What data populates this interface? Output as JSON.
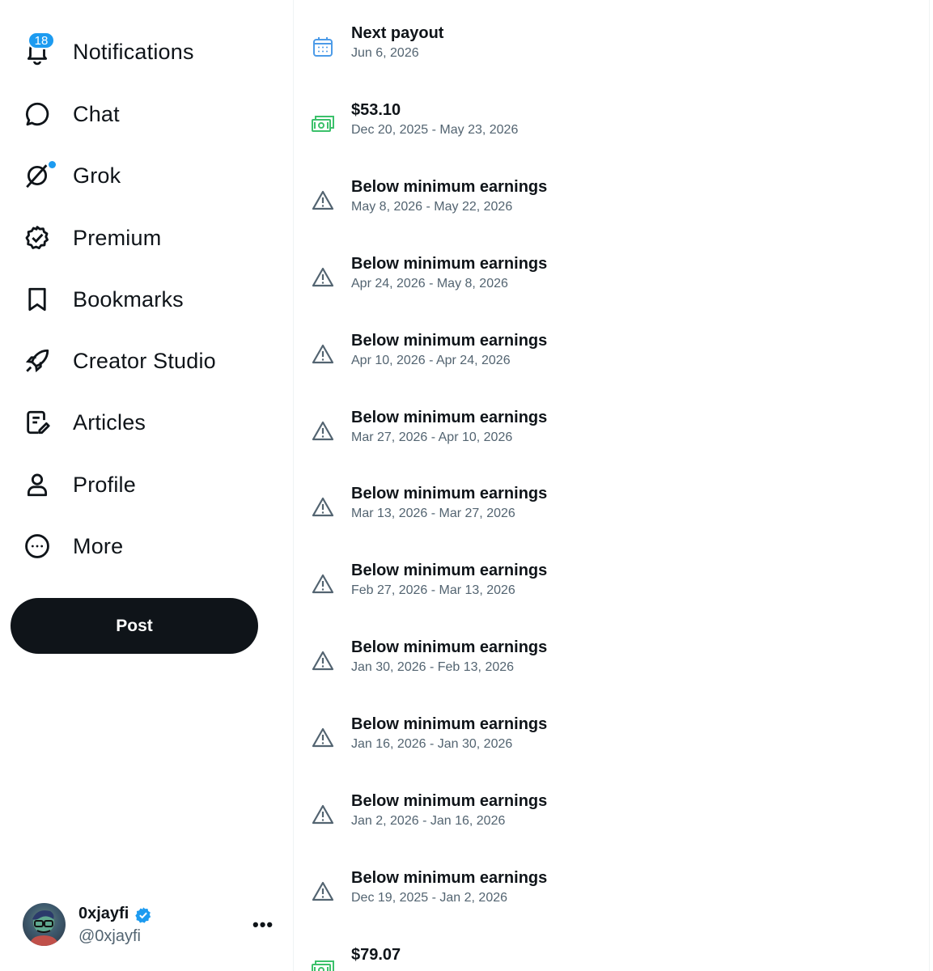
{
  "nav": {
    "items": [
      {
        "label": "Notifications",
        "icon": "bell-icon",
        "badge": "18"
      },
      {
        "label": "Chat",
        "icon": "chat-bubble-icon"
      },
      {
        "label": "Grok",
        "icon": "grok-icon"
      },
      {
        "label": "Premium",
        "icon": "premium-badge-icon"
      },
      {
        "label": "Bookmarks",
        "icon": "bookmark-icon"
      },
      {
        "label": "Creator Studio",
        "icon": "rocket-icon"
      },
      {
        "label": "Articles",
        "icon": "article-edit-icon"
      },
      {
        "label": "Profile",
        "icon": "person-icon"
      },
      {
        "label": "More",
        "icon": "more-circle-icon"
      }
    ],
    "post_label": "Post"
  },
  "account": {
    "name": "0xjayfi",
    "handle": "@0xjayfi",
    "more_label": "•••"
  },
  "colors": {
    "accent": "#1d9bf0",
    "text_primary": "#0f1419",
    "text_secondary": "#536471",
    "payout_green": "#3cc16b",
    "calendar_blue": "#4c9be8"
  },
  "payouts": [
    {
      "type": "calendar",
      "icon": "calendar-icon",
      "title": "Next payout",
      "subtitle": "Jun 6, 2026"
    },
    {
      "type": "money",
      "icon": "cash-icon",
      "title": "$53.10",
      "subtitle": "Dec 20, 2025 - May 23, 2026"
    },
    {
      "type": "warning",
      "icon": "warning-icon",
      "title": "Below minimum earnings",
      "subtitle": "May 8, 2026 - May 22, 2026"
    },
    {
      "type": "warning",
      "icon": "warning-icon",
      "title": "Below minimum earnings",
      "subtitle": "Apr 24, 2026 - May 8, 2026"
    },
    {
      "type": "warning",
      "icon": "warning-icon",
      "title": "Below minimum earnings",
      "subtitle": "Apr 10, 2026 - Apr 24, 2026"
    },
    {
      "type": "warning",
      "icon": "warning-icon",
      "title": "Below minimum earnings",
      "subtitle": "Mar 27, 2026 - Apr 10, 2026"
    },
    {
      "type": "warning",
      "icon": "warning-icon",
      "title": "Below minimum earnings",
      "subtitle": "Mar 13, 2026 - Mar 27, 2026"
    },
    {
      "type": "warning",
      "icon": "warning-icon",
      "title": "Below minimum earnings",
      "subtitle": "Feb 27, 2026 - Mar 13, 2026"
    },
    {
      "type": "warning",
      "icon": "warning-icon",
      "title": "Below minimum earnings",
      "subtitle": "Jan 30, 2026 - Feb 13, 2026"
    },
    {
      "type": "warning",
      "icon": "warning-icon",
      "title": "Below minimum earnings",
      "subtitle": "Jan 16, 2026 - Jan 30, 2026"
    },
    {
      "type": "warning",
      "icon": "warning-icon",
      "title": "Below minimum earnings",
      "subtitle": "Jan 2, 2026 - Jan 16, 2026"
    },
    {
      "type": "warning",
      "icon": "warning-icon",
      "title": "Below minimum earnings",
      "subtitle": "Dec 19, 2025 - Jan 2, 2026"
    },
    {
      "type": "money",
      "icon": "cash-icon",
      "title": "$79.07",
      "subtitle": ""
    }
  ]
}
